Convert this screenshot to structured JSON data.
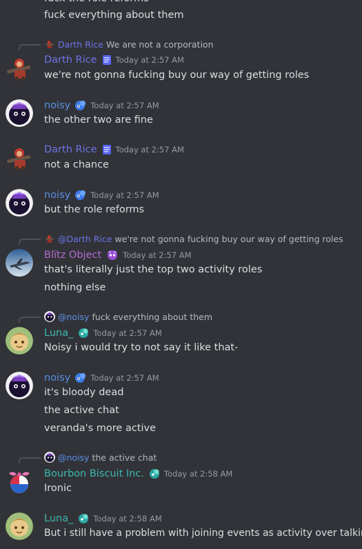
{
  "top_partial": {
    "line1": "fuck the role reforms",
    "line2": "fuck everything about them"
  },
  "msg1": {
    "reply_name": "Darth Rice",
    "reply_text": "We are not a corporation",
    "author": "Darth Rice",
    "time": "Today at 2:57 AM",
    "line1": "we're not gonna fucking buy our way of getting roles"
  },
  "msg2": {
    "author": "noisy",
    "time": "Today at 2:57 AM",
    "line1": "the other two are fine"
  },
  "msg3": {
    "author": "Darth Rice",
    "time": "Today at 2:57 AM",
    "line1": "not a chance"
  },
  "msg4": {
    "author": "noisy",
    "time": "Today at 2:57 AM",
    "line1": "but the role reforms"
  },
  "msg5": {
    "reply_name": "@Darth Rice",
    "reply_text": "we're not gonna fucking buy our way of getting roles",
    "author": "Blïtz Object",
    "time": "Today at 2:57 AM",
    "line1": "that's literally just the top two activity roles",
    "line2": "nothing else"
  },
  "msg6": {
    "reply_name": "@noisy",
    "reply_text": "fuck everything about them",
    "author": "Luna_",
    "time": "Today at 2:57 AM",
    "line1": "Noisy i would try to not say it like that-"
  },
  "msg7": {
    "author": "noisy",
    "time": "Today at 2:57 AM",
    "line1": "it's bloody dead",
    "line2": "the active chat",
    "line3": "veranda's more active"
  },
  "msg8": {
    "reply_name": "@noisy",
    "reply_text": "the active chat",
    "author": "Bourbon Biscuit Inc.",
    "time": "Today at 2:58 AM",
    "line1": "Ironic"
  },
  "msg9": {
    "author": "Luna_",
    "time": "Today at 2:58 AM",
    "line1": "But i still have a problem with joining events as activity over talking"
  },
  "colors": {
    "background": "#313338",
    "text": "#dbdee1",
    "timestamp": "#949ba4",
    "darth_rice": "#6d75e8",
    "noisy": "#5a8fe6",
    "blitz_object": "#b66ad1",
    "teal_names": "#3db8b0"
  },
  "icons": {
    "darth_badge": "blue-book-icon",
    "noisy_badge": "blue-sticker-icon",
    "blitz_badge": "purple-sticker-icon",
    "teal_badge": "teal-sticker-icon"
  }
}
